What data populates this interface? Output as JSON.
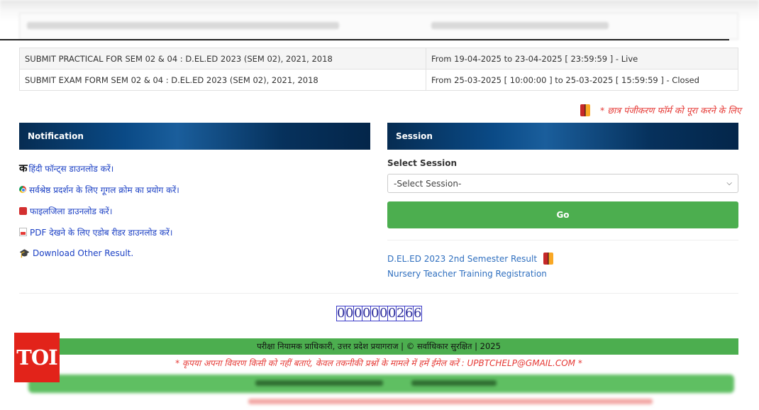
{
  "exam_rows": [
    {
      "name": "SUBMIT PRACTICAL FOR SEM 02 & 04 : D.EL.ED 2023 (SEM 02), 2021, 2018",
      "schedule": "From 19-04-2025 to 23-04-2025 [ 23:59:59 ] - Live"
    },
    {
      "name": "SUBMIT EXAM FORM SEM 02 & 04 : D.EL.ED 2023 (SEM 02), 2021, 2018",
      "schedule": "From 25-03-2025 [ 10:00:00 ] to 25-03-2025 [ 15:59:59 ] - Closed"
    }
  ],
  "warning_text": "* छात्र पंजीकरण फॉर्म को पूरा करने के लिए",
  "notification": {
    "title": "Notification",
    "items": [
      {
        "icon": "ka-letter-icon",
        "glyph": "क",
        "label": "हिंदी फॉन्ट्स डाउनलोड करें।"
      },
      {
        "icon": "chrome-icon",
        "label": "सर्वश्रेष्ठ प्रदर्शन के लिए गूगल क्रोम का प्रयोग करें।"
      },
      {
        "icon": "zip-file-icon",
        "label": "फाइलजिला डाउनलोड करें।"
      },
      {
        "icon": "pdf-icon",
        "label": "PDF देखने के लिए एडोब रीडर डाउनलोड करें।"
      },
      {
        "icon": "graduation-cap-icon",
        "glyph": "🎓",
        "label": "Download Other Result."
      }
    ]
  },
  "session": {
    "title": "Session",
    "select_label": "Select Session",
    "select_value": "-Select Session-",
    "go_label": "Go",
    "links": [
      {
        "label": "D.EL.ED 2023 2nd Semester Result"
      },
      {
        "label": "Nursery Teacher Training Registration"
      }
    ]
  },
  "visitor_counter": [
    "0",
    "0",
    "0",
    "0",
    "0",
    "0",
    "0",
    "2",
    "6",
    "6"
  ],
  "footer": {
    "copyright": "परीक्षा नियामक प्राधिकारी, उत्तर प्रदेश प्रयागराज | © सर्वाधिकार सुरक्षित | 2025",
    "note": "* कृपया अपना विवरण किसी को नहीं बताएं, केवल तकनीकी प्रश्नों के मामले में हमें ईमेल करें : UPBTCHELP@GMAIL.COM *"
  },
  "watermark": {
    "text": "TOI",
    "color": "#e2231a"
  },
  "colors": {
    "panel_header": "#0a4a86",
    "go_button": "#4cae4f",
    "link": "#2f6fbf",
    "warning": "#e53935"
  }
}
